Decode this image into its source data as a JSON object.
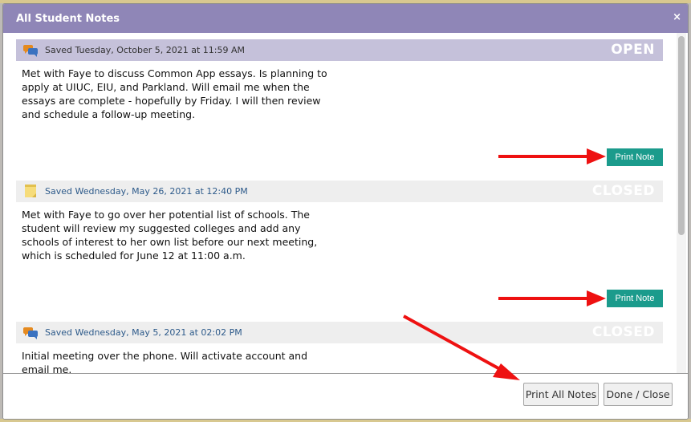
{
  "dialog": {
    "title": "All Student Notes",
    "close_icon": "×"
  },
  "notes": [
    {
      "saved": "Saved Tuesday, October 5, 2021 at 11:59 AM",
      "status": "OPEN",
      "body": "Met with Faye to discuss Common App essays. Is planning to apply at UIUC, EIU, and Parkland. Will email me when the essays are complete - hopefully by Friday. I will then review and schedule a follow-up meeting.",
      "print_label": "Print Note",
      "icon": "chat-bubbles-icon"
    },
    {
      "saved": "Saved Wednesday, May 26, 2021 at 12:40 PM",
      "status": "CLOSED",
      "body": "Met with Faye to go over her potential list of schools. The student will review my suggested colleges and add any schools of interest to her own list before our next meeting, which is scheduled for June 12 at 11:00 a.m.",
      "print_label": "Print Note",
      "icon": "sticky-note-icon"
    },
    {
      "saved": "Saved Wednesday, May 5, 2021 at 02:02 PM",
      "status": "CLOSED",
      "body": "Initial meeting over the phone. Will activate account and email me.",
      "icon": "chat-bubbles-icon"
    }
  ],
  "footer": {
    "print_all_label": "Print All Notes",
    "done_label": "Done / Close"
  },
  "colors": {
    "titlebar": "#8f86b7",
    "open_header": "#c5c1da",
    "closed_header": "#eeeeee",
    "print_button": "#1b9b8c",
    "annotation_arrow": "#ee1111"
  }
}
